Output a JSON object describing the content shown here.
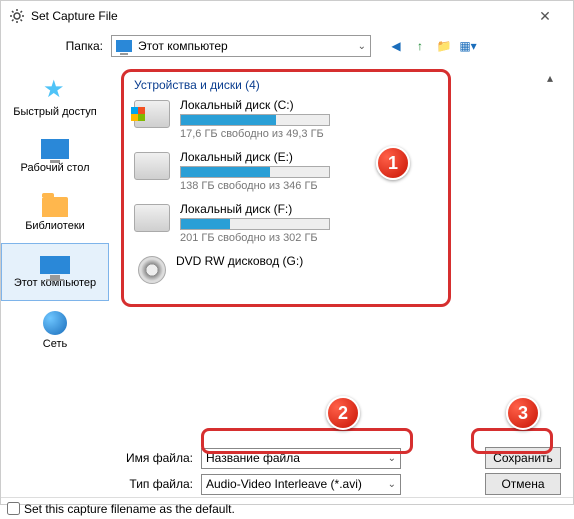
{
  "title": "Set Capture File",
  "toolbar": {
    "folder_label": "Папка:",
    "folder_value": "Этот компьютер"
  },
  "sidebar": {
    "items": [
      {
        "label": "Быстрый доступ"
      },
      {
        "label": "Рабочий стол"
      },
      {
        "label": "Библиотеки"
      },
      {
        "label": "Этот компьютер"
      },
      {
        "label": "Сеть"
      }
    ]
  },
  "main": {
    "section_header": "Устройства и диски (4)",
    "drives": [
      {
        "name": "Локальный диск (C:)",
        "free": "17,6 ГБ свободно из 49,3 ГБ",
        "pct": 64
      },
      {
        "name": "Локальный диск (E:)",
        "free": "138 ГБ свободно из 346 ГБ",
        "pct": 60
      },
      {
        "name": "Локальный диск (F:)",
        "free": "201 ГБ свободно из 302 ГБ",
        "pct": 33
      },
      {
        "name": "DVD RW дисковод (G:)"
      }
    ]
  },
  "footer": {
    "filename_label": "Имя файла:",
    "filename_value": "Название файла",
    "filetype_label": "Тип файла:",
    "filetype_value": "Audio-Video Interleave (*.avi)",
    "save_label": "Сохранить",
    "cancel_label": "Отмена"
  },
  "checkbox_label": "Set this capture filename as the default.",
  "badges": [
    "1",
    "2",
    "3"
  ]
}
